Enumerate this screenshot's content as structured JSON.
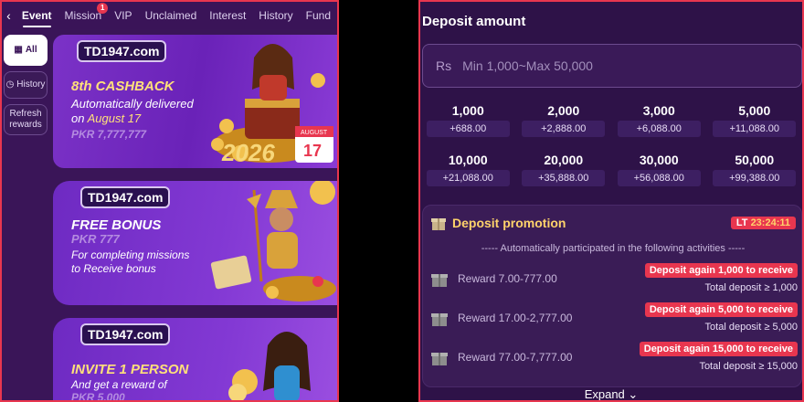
{
  "tabs": {
    "back_icon": "back-icon",
    "items": [
      {
        "label": "Event",
        "active": true
      },
      {
        "label": "Mission",
        "badge": "1"
      },
      {
        "label": "VIP"
      },
      {
        "label": "Unclaimed"
      },
      {
        "label": "Interest"
      },
      {
        "label": "History"
      },
      {
        "label": "Fund"
      }
    ]
  },
  "sidebar": {
    "items": [
      {
        "label": "All",
        "icon": "grid-icon",
        "active": true
      },
      {
        "label": "History",
        "icon": "history-icon"
      },
      {
        "label": "Refresh rewards"
      }
    ]
  },
  "banners": [
    {
      "logo": "TD1947.com",
      "title": "8th CASHBACK",
      "line1": "Automatically delivered",
      "line2_prefix": "on",
      "line2_highlight": "August 17",
      "amount": "PKR 7,777,777",
      "art_text_year": "2026",
      "art_text_cal_month": "AUGUST",
      "art_text_cal_day": "17"
    },
    {
      "logo": "TD1947.com",
      "title": "FREE BONUS",
      "amount": "PKR 777",
      "line1": "For completing missions",
      "line2": "to Receive bonus"
    },
    {
      "logo": "TD1947.com",
      "title_prefix": "INVITE",
      "title_highlight": "1",
      "title_suffix": "PERSON",
      "line1": "And get a reward of",
      "amount": "PKR 5,000"
    }
  ],
  "deposit": {
    "title": "Deposit amount",
    "currency": "Rs",
    "placeholder": "Min 1,000~Max 50,000",
    "amounts": [
      {
        "value": "1,000",
        "bonus": "+688.00"
      },
      {
        "value": "2,000",
        "bonus": "+2,888.00"
      },
      {
        "value": "3,000",
        "bonus": "+6,088.00"
      },
      {
        "value": "5,000",
        "bonus": "+11,088.00"
      },
      {
        "value": "10,000",
        "bonus": "+21,088.00"
      },
      {
        "value": "20,000",
        "bonus": "+35,888.00"
      },
      {
        "value": "30,000",
        "bonus": "+56,088.00"
      },
      {
        "value": "50,000",
        "bonus": "+99,388.00"
      }
    ]
  },
  "promotion": {
    "title": "Deposit promotion",
    "timer_prefix": "LT",
    "timer": "23:24:11",
    "note": "----- Automatically participated in the following activities -----",
    "rewards": [
      {
        "text": "Reward 7.00-777.00",
        "button": "Deposit again 1,000 to receive",
        "total": "Total deposit ≥ 1,000"
      },
      {
        "text": "Reward 17.00-2,777.00",
        "button": "Deposit again 5,000 to receive",
        "total": "Total deposit ≥ 5,000"
      },
      {
        "text": "Reward 77.00-7,777.00",
        "button": "Deposit again 15,000 to receive",
        "total": "Total deposit ≥ 15,000"
      }
    ],
    "expand_label": "Expand"
  },
  "colors": {
    "accent_red": "#e8364f",
    "gold": "#ffd36b",
    "panel_bg": "#2e1248"
  }
}
